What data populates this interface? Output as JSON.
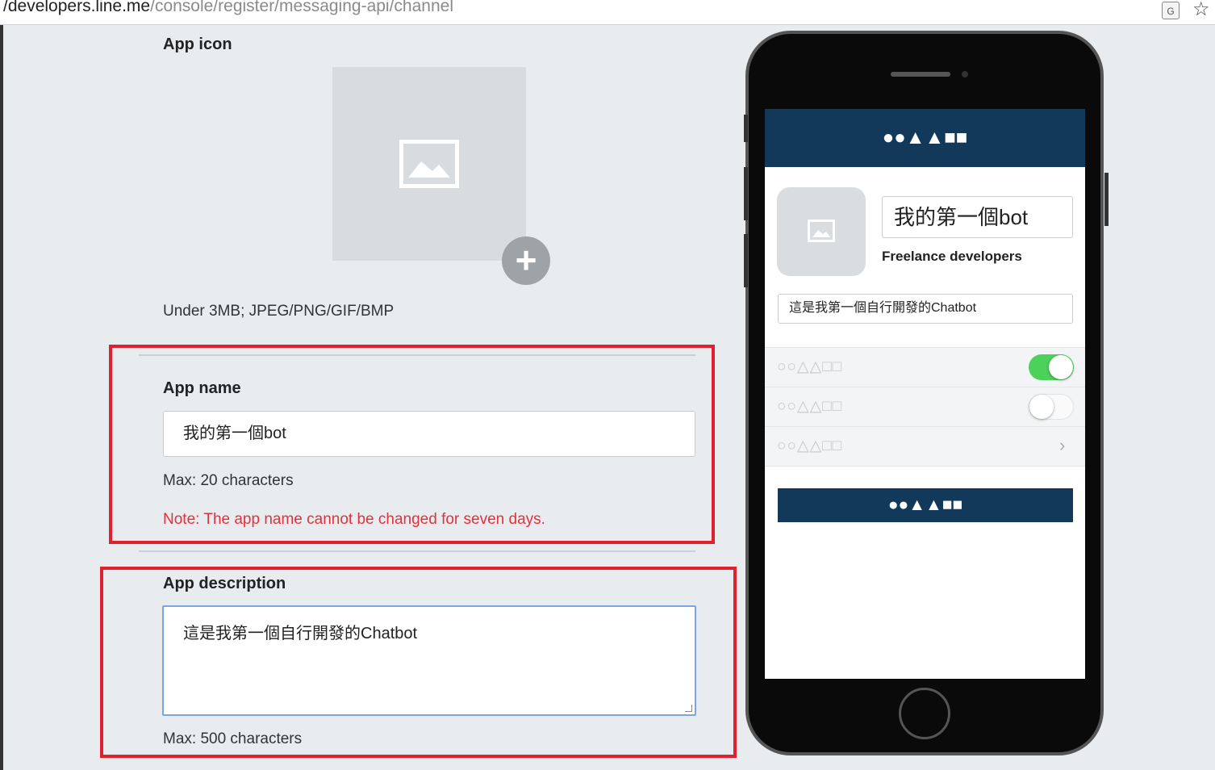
{
  "browser": {
    "url_host": "/developers.line.me",
    "url_path": "/console/register/messaging-api/channel",
    "translate_icon": "translate-icon",
    "star_icon": "star-icon"
  },
  "form": {
    "app_icon": {
      "label": "App icon",
      "add_glyph": "+",
      "hint": "Under 3MB; JPEG/PNG/GIF/BMP"
    },
    "app_name": {
      "label": "App name",
      "value": "我的第一個bot",
      "hint": "Max: 20 characters",
      "note": "Note: The app name cannot be changed for seven days."
    },
    "app_description": {
      "label": "App description",
      "value": "這是我第一個自行開發的Chatbot",
      "hint": "Max: 500 characters"
    }
  },
  "preview": {
    "header_glyphs": "●●▲▲■■",
    "name": "我的第一個bot",
    "provider": "Freelance developers",
    "description": "這是我第一個自行開發的Chatbot",
    "rows": [
      {
        "label": "○○△△□□",
        "control": "toggle",
        "state": "on"
      },
      {
        "label": "○○△△□□",
        "control": "toggle",
        "state": "off"
      },
      {
        "label": "○○△△□□",
        "control": "chevron"
      }
    ],
    "chevron": "›",
    "button_glyphs": "●●▲▲■■",
    "colors": {
      "header": "#13395a",
      "toggle_on": "#4cd15a",
      "highlight": "#e0202e",
      "note": "#e0323e"
    }
  }
}
